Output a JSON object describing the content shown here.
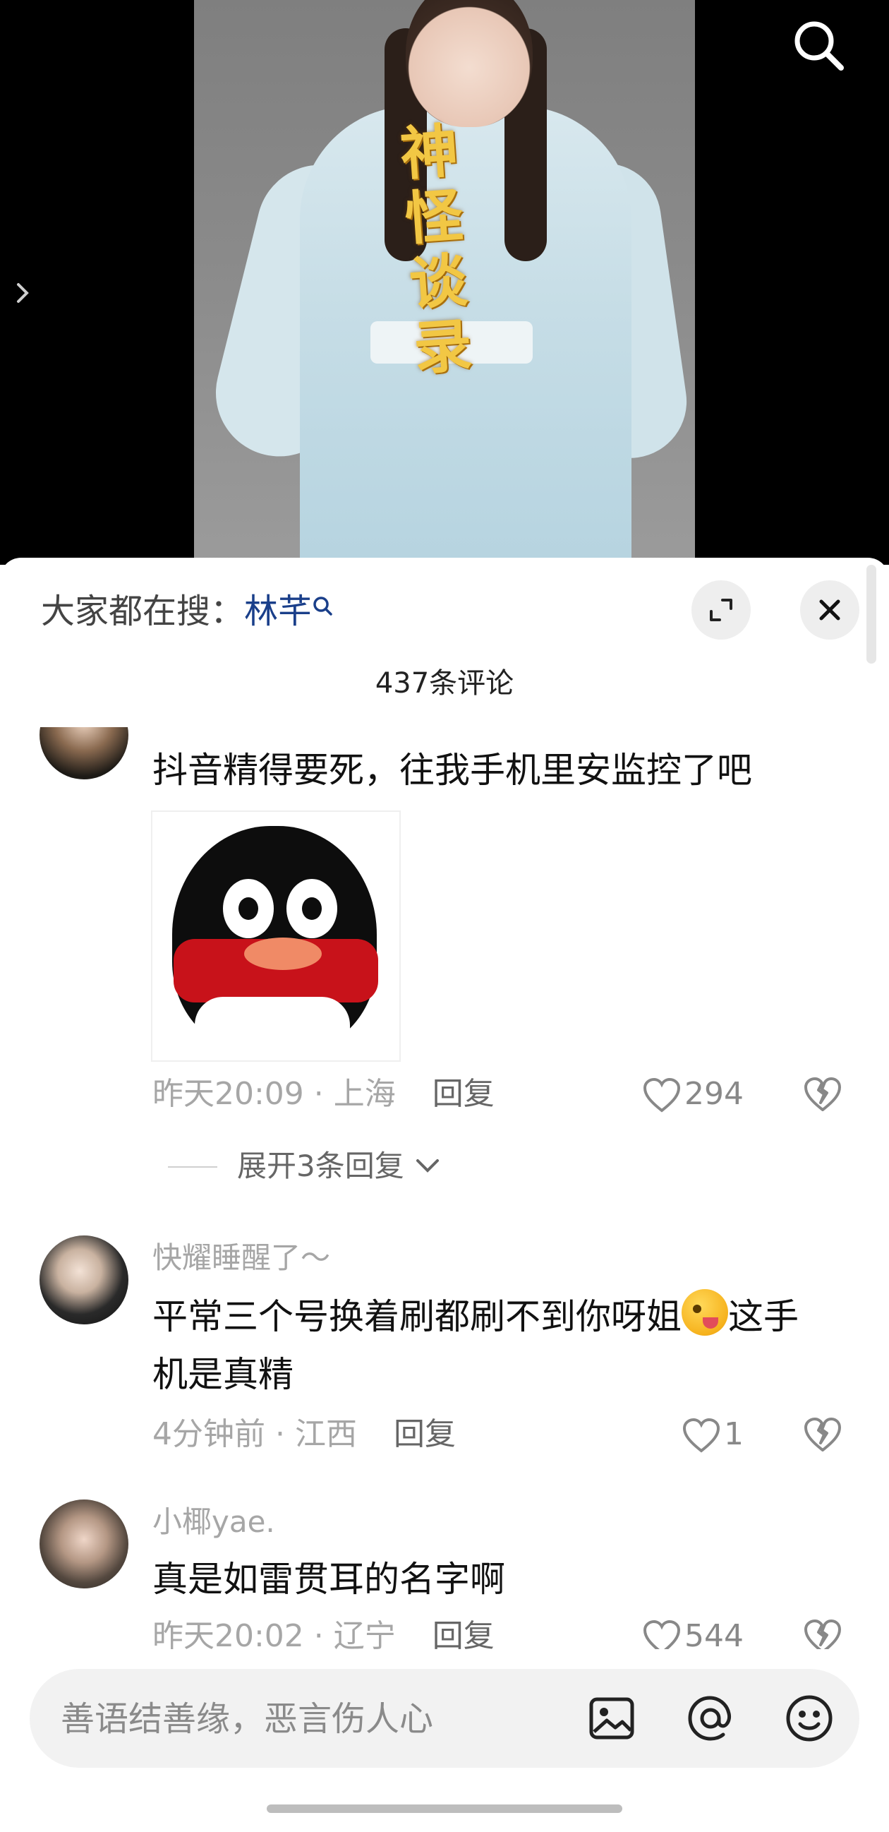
{
  "video": {
    "title_calligraphy": "神\n怪\n谈\n录"
  },
  "sheet": {
    "hot_search_label": "大家都在搜：",
    "hot_search_keyword": "林芊",
    "comment_count": "437条评论"
  },
  "comments": [
    {
      "text": "抖音精得要死，往我手机里安监控了吧",
      "time": "昨天20:09",
      "location": "上海",
      "reply": "回复",
      "likes": "294",
      "expand_replies": "展开3条回复"
    },
    {
      "username": "快耀睡醒了～",
      "text_before": "平常三个号换着刷都刷不到你呀姐",
      "text_after": "这手",
      "text_line2": "机是真精",
      "time": "4分钟前",
      "location": "江西",
      "reply": "回复",
      "likes": "1"
    },
    {
      "username": "小椰yae.",
      "text": "真是如雷贯耳的名字啊",
      "time": "昨天20:02",
      "location": "辽宁",
      "reply": "回复",
      "likes": "544"
    }
  ],
  "input": {
    "placeholder": "善语结善缘，恶言伤人心"
  },
  "colors": {
    "keyword": "#1a3f8a",
    "meta_gray": "#a6a6a6",
    "bar_bg": "#f2f2f2"
  },
  "icons": [
    "search-icon",
    "chevron-right-icon",
    "magnifier-small-icon",
    "expand-icon",
    "close-icon",
    "heart-icon",
    "broken-heart-icon",
    "chevron-down-icon",
    "image-icon",
    "at-icon",
    "emoji-icon"
  ]
}
